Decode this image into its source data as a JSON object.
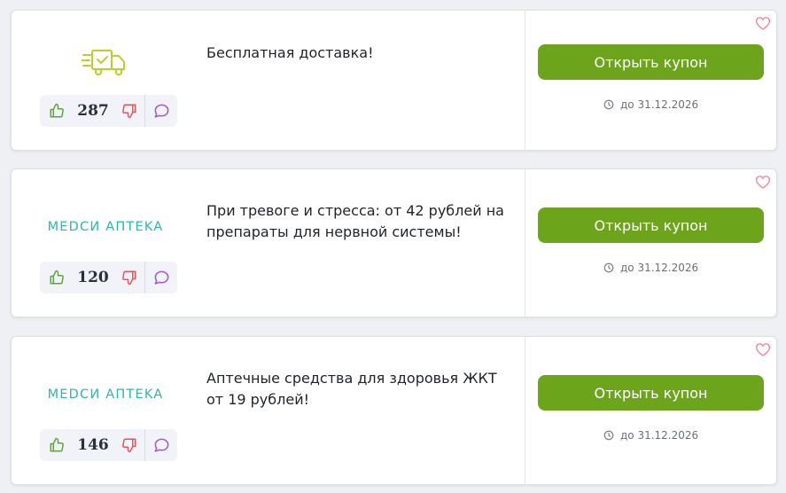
{
  "coupons": [
    {
      "logo": {
        "type": "delivery-truck-icon"
      },
      "title": "Бесплатная доставка!",
      "votes": "287",
      "button_label": "Открыть купон",
      "expiry": "до 31.12.2026"
    },
    {
      "logo": {
        "type": "text",
        "text": "MEDCИ AПTEKA"
      },
      "title": "При тревоге и стресса: от 42 рублей на препараты для нервной системы!",
      "votes": "120",
      "button_label": "Открыть купон",
      "expiry": "до 31.12.2026"
    },
    {
      "logo": {
        "type": "text",
        "text": "MEDCИ AПTEKA"
      },
      "title": "Аптечные средства для здоровья ЖКТ от 19 рублей!",
      "votes": "146",
      "button_label": "Открыть купон",
      "expiry": "до 31.12.2026"
    }
  ],
  "icons": {
    "like": "thumbs-up-icon",
    "dislike": "thumbs-down-icon",
    "comment": "comment-icon",
    "favorite": "heart-icon",
    "clock": "clock-icon"
  },
  "colors": {
    "button_green": "#6ca51c",
    "brand_teal": "#2cb6ad",
    "truck_lime": "#b6d12b",
    "like_green": "#5aa83a",
    "dislike_red": "#e0565b",
    "comment_purple": "#a35cc9",
    "heart_pink": "#f08a9a"
  }
}
